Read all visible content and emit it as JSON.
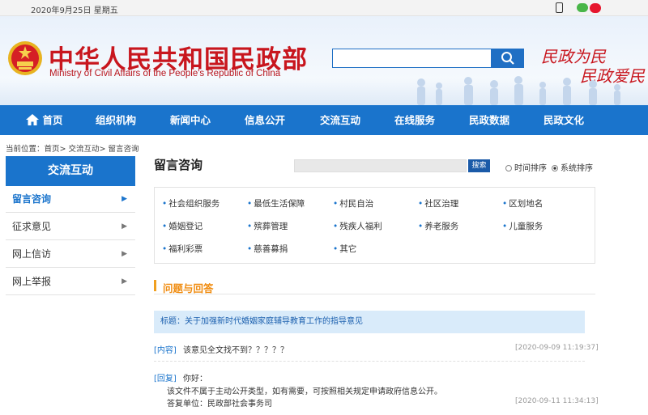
{
  "topbar": {
    "date": "2020年9月25日 星期五"
  },
  "header": {
    "title": "中华人民共和国民政部",
    "subtitle": "Ministry of Civil Affairs of the People's Republic of China",
    "search_placeholder": "",
    "slogan_line1": "民政为民",
    "slogan_line2": "民政爱民"
  },
  "nav": {
    "items": [
      "首页",
      "组织机构",
      "新闻中心",
      "信息公开",
      "交流互动",
      "在线服务",
      "民政数据",
      "民政文化"
    ]
  },
  "breadcrumb": "当前位置：首页> 交流互动> 留言咨询",
  "sidebar": {
    "heading": "交流互动",
    "items": [
      "留言咨询",
      "征求意见",
      "网上信访",
      "网上举报"
    ]
  },
  "main": {
    "title": "留言咨询",
    "search_button": "搜索",
    "sort_time": "时间排序",
    "sort_system": "系统排序",
    "categories": [
      "社会组织服务",
      "最低生活保障",
      "村民自治",
      "社区治理",
      "区划地名",
      "婚姻登记",
      "殡葬管理",
      "残疾人福利",
      "养老服务",
      "儿童服务",
      "福利彩票",
      "慈善募捐",
      "其它"
    ],
    "qa_heading": "问题与回答",
    "question_title": "标题：关于加强新时代婚姻家庭辅导教育工作的指导意见",
    "content_tag": "[内容]",
    "content_text": "该意见全文找不到？？？？？",
    "content_time": "[2020-09-09 11:19:37]",
    "reply_tag": "[回复]",
    "reply_greeting": "你好：",
    "reply_text": "该文件不属于主动公开类型，如有需要，可按照相关规定申请政府信息公开。",
    "reply_unit": "答复单位：民政部社会事务司",
    "reply_time": "[2020-09-11 11:34:13]"
  },
  "colors": {
    "brand_blue": "#1a74cc",
    "brand_red": "#c8161e",
    "accent_orange": "#f08c10"
  }
}
